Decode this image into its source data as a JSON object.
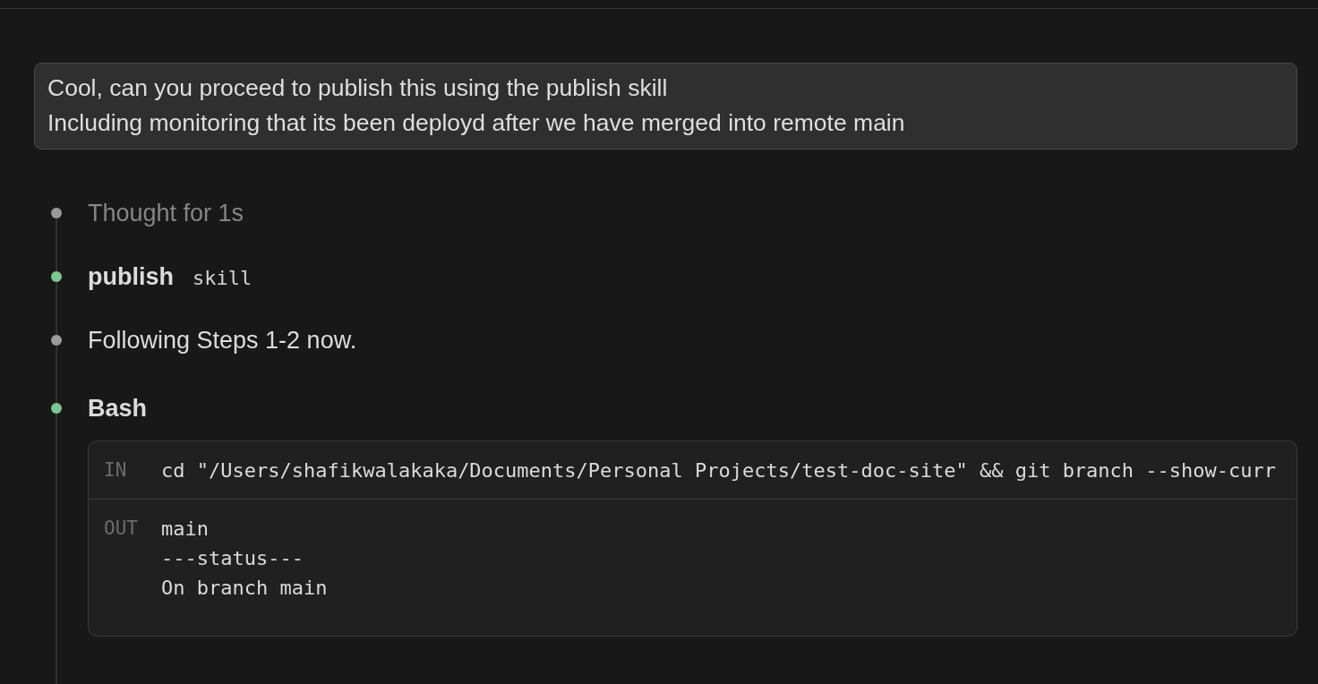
{
  "user_message": {
    "lines": [
      "Cool, can you proceed to publish this using the publish skill",
      "Including monitoring that its been deployd after we have merged into remote main"
    ]
  },
  "timeline": [
    {
      "kind": "thought",
      "text": "Thought for 1s",
      "color": "#9a9a9a"
    },
    {
      "kind": "skill",
      "name": "publish",
      "tag": "skill",
      "color": "#7cc68e"
    },
    {
      "kind": "message",
      "text": "Following Steps 1-2 now.",
      "color": "#9a9a9a"
    },
    {
      "kind": "tool",
      "name": "Bash",
      "color": "#7cc68e",
      "input": {
        "label": "IN",
        "command": "cd \"/Users/shafikwalakaka/Documents/Personal Projects/test-doc-site\" && git branch --show-curr"
      },
      "output": {
        "label": "OUT",
        "lines": [
          "main",
          "---status---",
          "On branch main"
        ]
      }
    }
  ]
}
